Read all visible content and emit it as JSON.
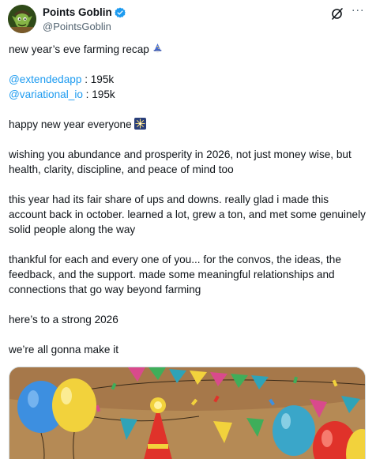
{
  "author": {
    "display_name": "Points Goblin",
    "handle": "@PointsGoblin",
    "verified": true,
    "avatar_icon": "goblin-avatar"
  },
  "actions": {
    "grok_icon": "grok-icon",
    "more_label": "···"
  },
  "tweet": {
    "line1": "new year’s eve farming recap",
    "line1_emoji": "wizard-emoji",
    "mention1": "@extendedapp",
    "mention1_value": " : 195k",
    "mention2": "@variational_io",
    "mention2_value": " : 195k",
    "line_happy": "happy new year everyone",
    "line_happy_emoji": "fireworks-emoji",
    "para_wishing": "wishing you abundance and prosperity in 2026, not just money wise, but health, clarity, discipline, and peace of mind too",
    "para_year": "this year had its fair share of ups and downs. really glad i made this account back in october. learned a lot, grew a ton, and met some genuinely solid people along the way",
    "para_thankful": "thankful for each and every one of you... for the convos, the ideas, the feedback, and the support. made some meaningful relationships and connections that go way beyond farming",
    "para_strong": "here’s to a strong 2026",
    "para_make_it": "we’re all gonna make it"
  },
  "media": {
    "description_icon": "party-illustration",
    "colors": {
      "wall": "#b58a55",
      "balloon_blue": "#3d8fe0",
      "balloon_yellow": "#f2d23c",
      "balloon_red": "#e0322a",
      "balloon_teal": "#3aa6c9",
      "flag_pink": "#d94a8c",
      "flag_green": "#3fae5a",
      "flag_teal": "#2fa3b8"
    }
  },
  "colors": {
    "link": "#1d9bf0",
    "text": "#0f1419",
    "secondary": "#536471",
    "verified": "#1d9bf0"
  }
}
